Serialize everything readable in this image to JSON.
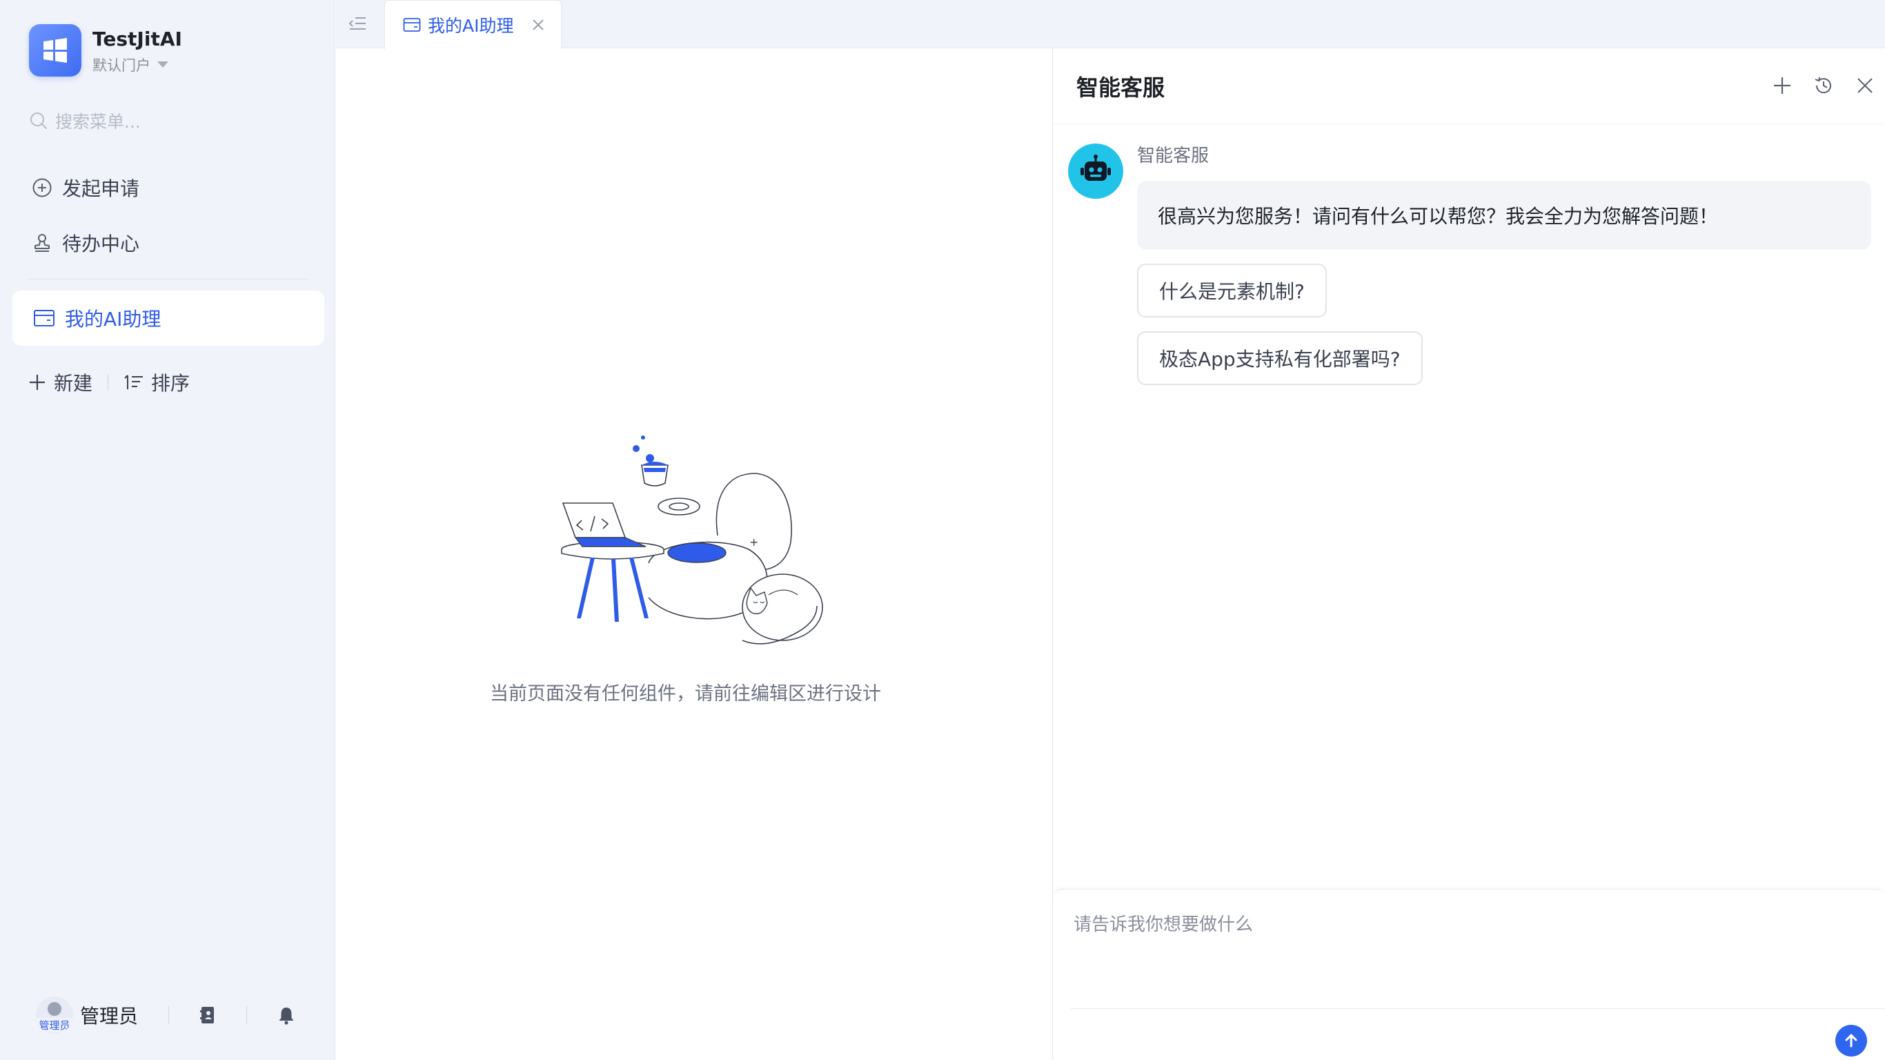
{
  "app": {
    "name": "TestJitAI",
    "portal": "默认门户"
  },
  "sidebar": {
    "search_placeholder": "搜索菜单...",
    "items": [
      {
        "label": "发起申请",
        "icon": "plus-circle-icon"
      },
      {
        "label": "待办中心",
        "icon": "stamp-icon"
      }
    ],
    "active_item": {
      "label": "我的AI助理",
      "icon": "wallet-icon"
    },
    "actions": {
      "new_label": "新建",
      "sort_label": "排序"
    }
  },
  "user": {
    "name": "管理员",
    "avatar_badge": "管理员"
  },
  "tabs": [
    {
      "label": "我的AI助理",
      "active": true
    }
  ],
  "main": {
    "empty_text": "当前页面没有任何组件，请前往编辑区进行设计"
  },
  "chat": {
    "title": "智能客服",
    "bot_name": "智能客服",
    "greeting": "很高兴为您服务！请问有什么可以帮您？我会全力为您解答问题！",
    "suggestions": [
      "什么是元素机制?",
      "极态App支持私有化部署吗?"
    ],
    "input_placeholder": "请告诉我你想要做什么"
  },
  "colors": {
    "accent": "#2f5bea",
    "sidebar_bg": "#f0f3fa",
    "bot_avatar": "#21c4e8",
    "send_button": "#2f66f0"
  }
}
